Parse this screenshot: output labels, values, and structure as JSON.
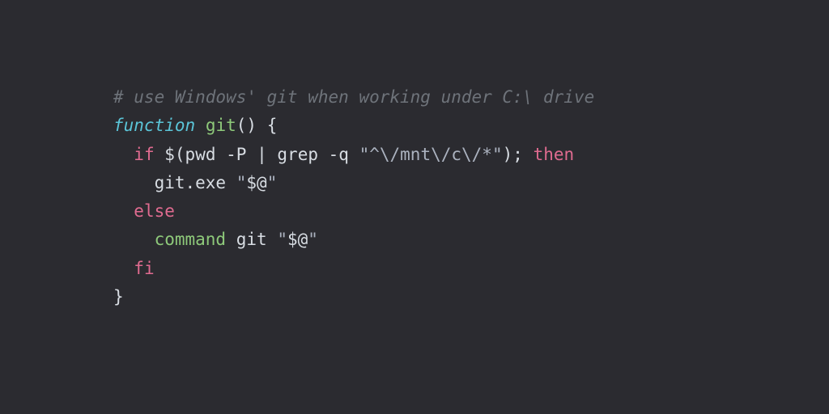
{
  "code": {
    "line1": {
      "comment": "# use Windows' git when working under C:\\ drive"
    },
    "line2": {
      "keyword": "function",
      "funcname": "git",
      "parens": "()",
      "brace": " {"
    },
    "line3": {
      "indent": "  ",
      "if": "if",
      "sp1": " ",
      "dollar": "$(",
      "cmd1": "pwd",
      "sp2": " ",
      "flag1": "-P",
      "sp3": " ",
      "pipe": "|",
      "sp4": " ",
      "cmd2": "grep",
      "sp5": " ",
      "flag2": "-q",
      "sp6": " ",
      "string": "\"^\\/mnt\\/c\\/*\"",
      "close": ")",
      "semi": ";",
      "sp7": " ",
      "then": "then"
    },
    "line4": {
      "indent": "    ",
      "cmd": "git.exe",
      "sp": " ",
      "q1": "\"",
      "var": "$@",
      "q2": "\""
    },
    "line5": {
      "indent": "  ",
      "else": "else"
    },
    "line6": {
      "indent": "    ",
      "builtin": "command",
      "sp1": " ",
      "cmd": "git",
      "sp2": " ",
      "q1": "\"",
      "var": "$@",
      "q2": "\""
    },
    "line7": {
      "indent": "  ",
      "fi": "fi"
    },
    "line8": {
      "brace": "}"
    }
  }
}
